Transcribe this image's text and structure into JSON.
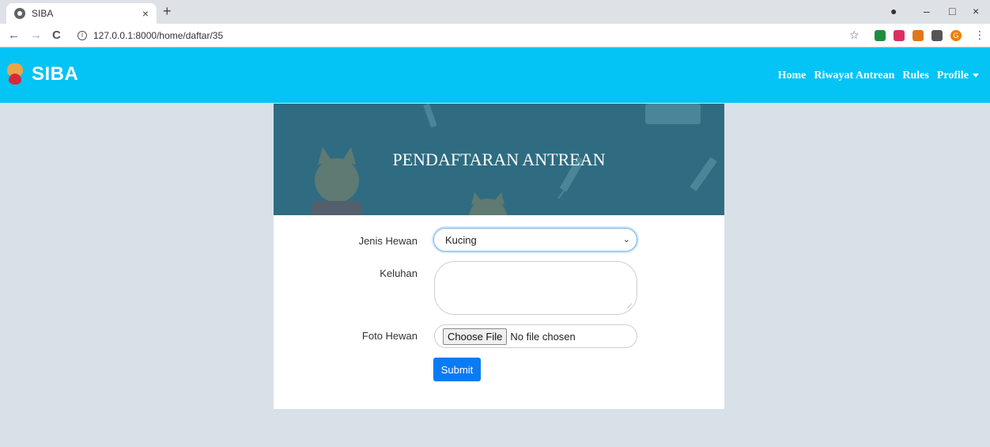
{
  "browser": {
    "tab_title": "SIBA",
    "tab_close": "×",
    "new_tab": "+",
    "url": "127.0.0.1:8000/home/daftar/35",
    "back": "←",
    "forward": "→",
    "reload": "C",
    "star": "☆",
    "menu": "⋮",
    "window_controls": [
      "–",
      "□",
      "×"
    ],
    "profile_initial": "G"
  },
  "navbar": {
    "brand": "SIBA",
    "links": [
      "Home",
      "Riwayat Antrean",
      "Rules",
      "Profile"
    ],
    "accent": "#03c4f5"
  },
  "card": {
    "title": "PENDAFTARAN ANTREAN",
    "header_color": "#2f6c81"
  },
  "form": {
    "jenis_label": "Jenis Hewan",
    "jenis_value": "Kucing",
    "keluhan_label": "Keluhan",
    "keluhan_value": "",
    "foto_label": "Foto Hewan",
    "choose_file": "Choose File",
    "no_file": "No file chosen",
    "submit": "Submit"
  }
}
